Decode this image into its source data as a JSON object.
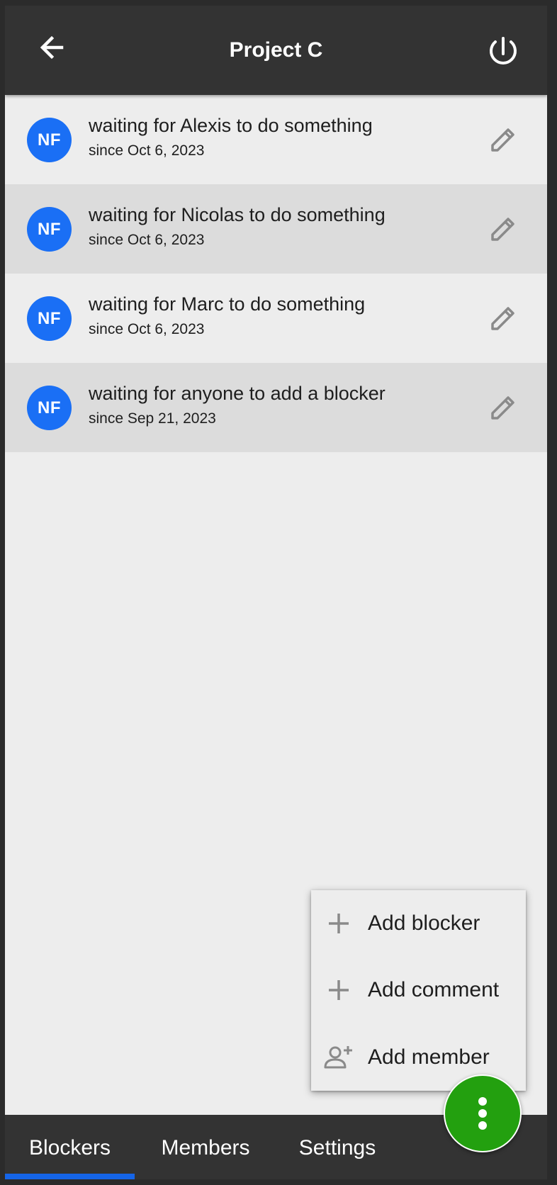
{
  "header": {
    "title": "Project C",
    "back_icon": "arrow-left-icon",
    "power_icon": "power-icon"
  },
  "blockers": [
    {
      "avatar": "NF",
      "title": "waiting for Alexis to do something",
      "since": "since Oct 6, 2023"
    },
    {
      "avatar": "NF",
      "title": "waiting for Nicolas to do something",
      "since": "since Oct 6, 2023"
    },
    {
      "avatar": "NF",
      "title": "waiting for Marc to do something",
      "since": "since Oct 6, 2023"
    },
    {
      "avatar": "NF",
      "title": "waiting for anyone to add a blocker",
      "since": "since Sep 21, 2023"
    }
  ],
  "menu": {
    "items": [
      {
        "label": "Add blocker",
        "icon": "plus-icon"
      },
      {
        "label": "Add comment",
        "icon": "plus-icon"
      },
      {
        "label": "Add member",
        "icon": "person-add-icon"
      }
    ]
  },
  "tabs": [
    {
      "label": "Blockers",
      "active": true
    },
    {
      "label": "Members",
      "active": false
    },
    {
      "label": "Settings",
      "active": false
    }
  ],
  "fab": {
    "icon": "more-vertical-icon"
  },
  "colors": {
    "header_bg": "#333333",
    "list_bg": "#ededed",
    "row_alt_bg": "#dcdcdc",
    "avatar_bg": "#1a6ff5",
    "fab_bg": "#23a00f",
    "tab_indicator": "#1565e8"
  }
}
